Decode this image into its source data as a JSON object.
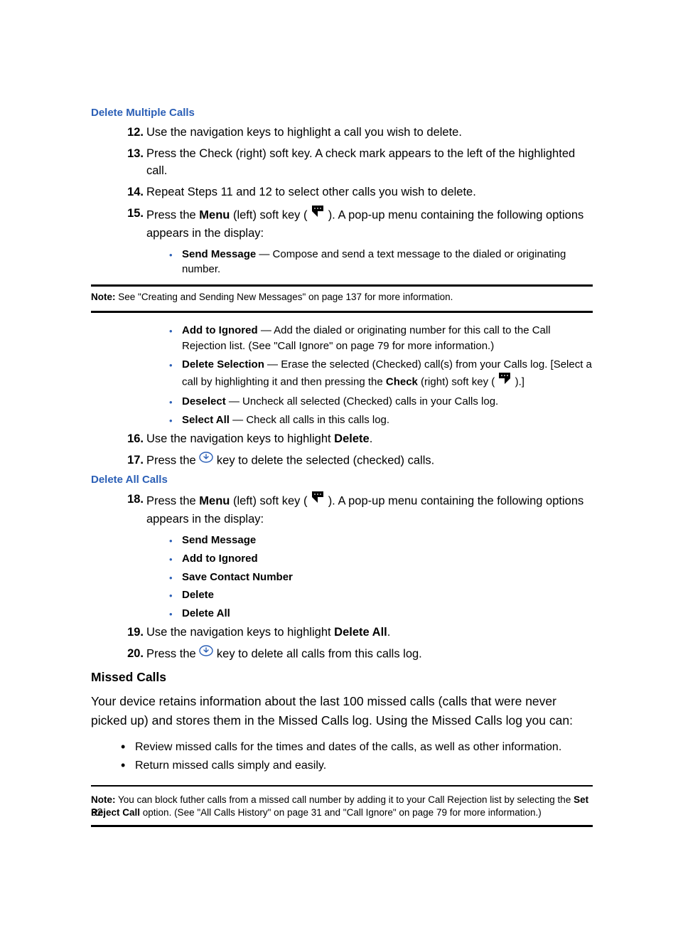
{
  "h1": "Delete Multiple Calls",
  "step12_num": "12.",
  "step12": "Use the navigation keys to highlight a call you wish to delete.",
  "step13_num": "13.",
  "step13": "Press the Check (right) soft key. A check mark appears to the left of the highlighted call.",
  "step14_num": "14.",
  "step14": "Repeat Steps 11 and 12 to select other calls you wish to delete.",
  "step15_num": "15.",
  "step15_a": "Press the ",
  "step15_menu": "Menu",
  "step15_b": " (left) soft key (",
  "step15_c": "). A pop-up menu containing the following options appears in the display:",
  "b_sendmsg_lbl": "Send Message",
  "b_sendmsg_txt": " — Compose and send a text message to the dialed or originating number.",
  "note1_lbl": "Note:",
  "note1_txt": " See \"Creating and Sending New Messages\" on page 137 for more information.",
  "b_add_lbl": "Add to Ignored",
  "b_add_txt": " — Add the dialed or originating number for this call to the Call Rejection list. (See \"Call Ignore\" on page 79 for more information.)",
  "b_delsel_lbl": "Delete Selection",
  "b_delsel_a": " — Erase the selected (Checked) call(s) from your Calls log. [Select a call by highlighting it and then pressing the ",
  "b_delsel_check": "Check",
  "b_delsel_b": " (right) soft key (",
  "b_delsel_c": ").]",
  "b_desel_lbl": "Deselect",
  "b_desel_txt": " — Uncheck all selected (Checked) calls in your Calls log.",
  "b_selall_lbl": "Select All",
  "b_selall_txt": " — Check all calls in this calls log.",
  "step16_num": "16.",
  "step16_a": "Use the navigation keys to highlight ",
  "step16_b": "Delete",
  "step16_c": ".",
  "step17_num": "17.",
  "step17_a": "Press the ",
  "step17_b": " key to delete the selected (checked) calls.",
  "h2": "Delete All Calls",
  "step18_num": "18.",
  "step18_a": "Press the ",
  "step18_menu": "Menu",
  "step18_b": " (left) soft key (",
  "step18_c": "). A pop-up menu containing the following options appears in the display:",
  "b2_sendmsg": "Send Message",
  "b2_add": "Add to Ignored",
  "b2_save": "Save Contact Number",
  "b2_del": "Delete",
  "b2_delall": "Delete All",
  "step19_num": "19.",
  "step19_a": "Use the navigation keys to highlight ",
  "step19_b": "Delete All",
  "step19_c": ".",
  "step20_num": "20.",
  "step20_a": "Press the ",
  "step20_b": " key to delete all calls from this calls log.",
  "h3": "Missed Calls",
  "p_missed": "Your device retains information about the last 100 missed calls (calls that were never picked up) and stores them in the Missed Calls log. Using the Missed Calls log you can:",
  "mb1": "Review missed calls for the times and dates of the calls, as well as other information.",
  "mb2": "Return missed calls simply and easily.",
  "note2_lbl": "Note:",
  "note2_a": " You can block futher calls from a missed call number by adding it to your Call Rejection list by selecting the ",
  "note2_b": "Set Reject Call",
  "note2_c": " option. (See \"All Calls History\" on page 31 and \"Call Ignore\" on page 79 for more information.)",
  "pagenum": "32"
}
